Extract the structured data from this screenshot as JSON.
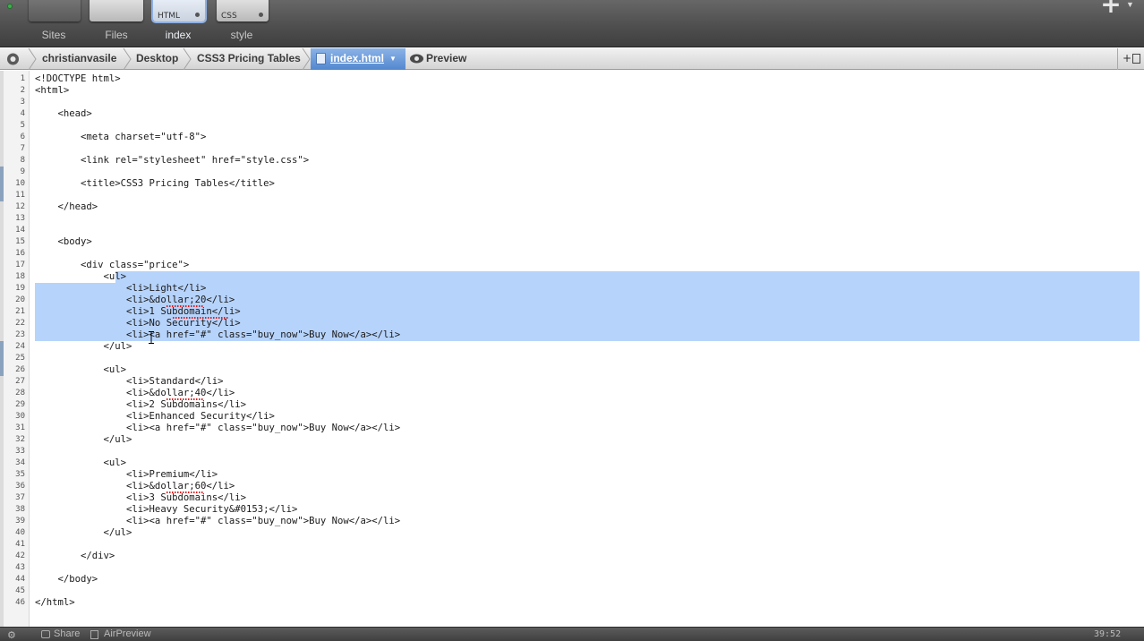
{
  "tabs": [
    {
      "name": "Sites",
      "thumb": "",
      "active": false
    },
    {
      "name": "Files",
      "thumb": "",
      "active": false
    },
    {
      "name": "index",
      "thumb": "HTML",
      "active": true
    },
    {
      "name": "style",
      "thumb": "CSS",
      "active": false
    }
  ],
  "breadcrumb": {
    "items": [
      "christianvasile",
      "Desktop",
      "CSS3 Pricing Tables"
    ],
    "current_file": "index.html",
    "preview_label": "Preview"
  },
  "editor": {
    "selected_lines": [
      18,
      23
    ],
    "cursor_line": 23,
    "lines": [
      "<!DOCTYPE html>",
      "<html>",
      "",
      "    <head>",
      "",
      "        <meta charset=\"utf-8\">",
      "",
      "        <link rel=\"stylesheet\" href=\"style.css\">",
      "",
      "        <title>CSS3 Pricing Tables</title>",
      "",
      "    </head>",
      "",
      "",
      "    <body>",
      "",
      "        <div class=\"price\">",
      "            <ul>",
      "                <li>Light</li>",
      "                <li>&dollar;20</li>",
      "                <li>1 Subdomain</li>",
      "                <li>No Security</li>",
      "                <li><a href=\"#\" class=\"buy_now\">Buy Now</a></li>",
      "            </ul>",
      "",
      "            <ul>",
      "                <li>Standard</li>",
      "                <li>&dollar;40</li>",
      "                <li>2 Subdomains</li>",
      "                <li>Enhanced Security</li>",
      "                <li><a href=\"#\" class=\"buy_now\">Buy Now</a></li>",
      "            </ul>",
      "",
      "            <ul>",
      "                <li>Premium</li>",
      "                <li>&dollar;60</li>",
      "                <li>3 Subdomains</li>",
      "                <li>Heavy Security&#0153;</li>",
      "                <li><a href=\"#\" class=\"buy_now\">Buy Now</a></li>",
      "            </ul>",
      "",
      "        </div>",
      "",
      "    </body>",
      "",
      "</html>"
    ]
  },
  "status": {
    "share_label": "Share",
    "airpreview_label": "AirPreview",
    "cursor_position": "39:52"
  },
  "icons": {
    "gear": "gear-icon",
    "preview": "eye-icon",
    "add_pane": "plus-icon",
    "split": "split-view-icon"
  },
  "colors": {
    "selection": "#b6d3fb",
    "active_crumb": "#5287cf",
    "toolbar_dark": "#4f4f4f"
  }
}
